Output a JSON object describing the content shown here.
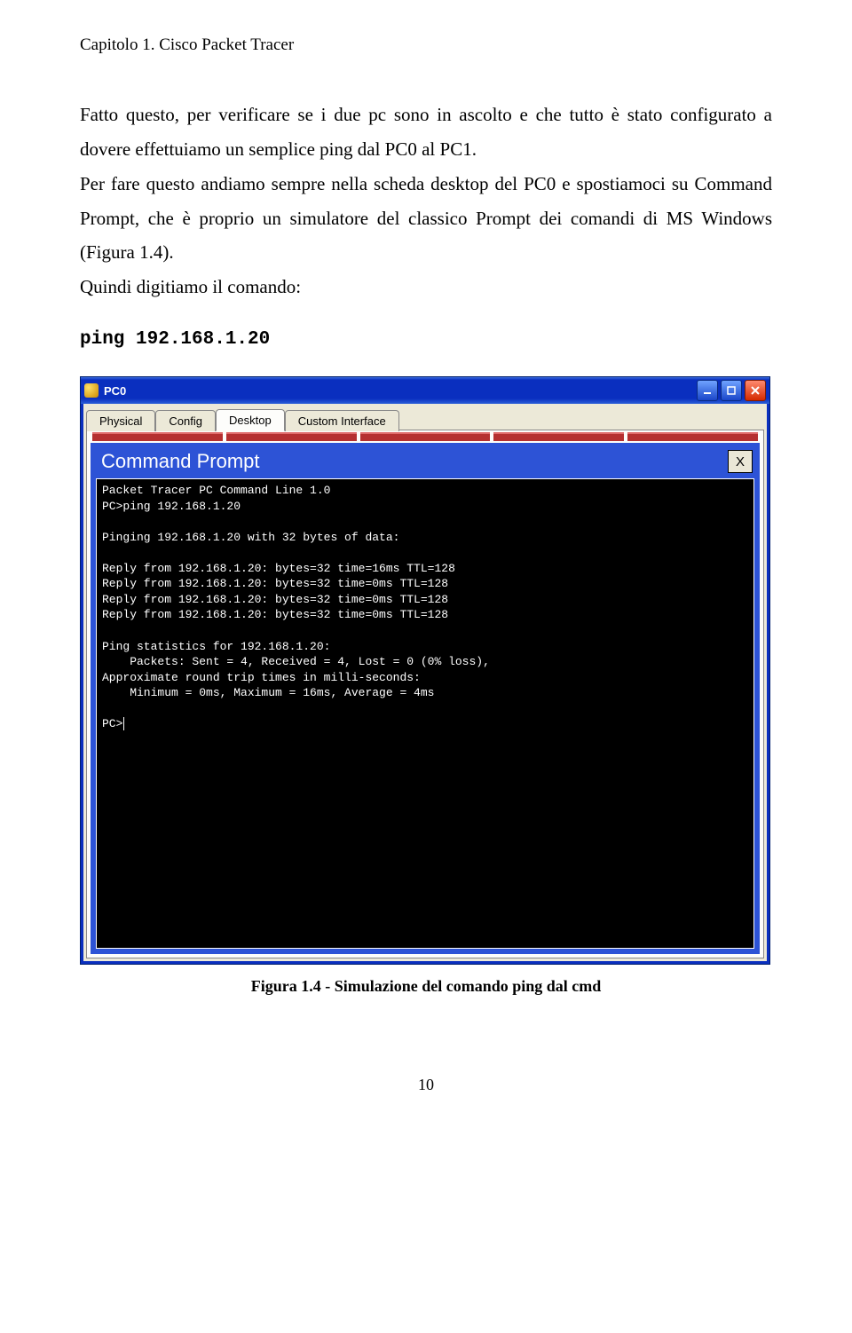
{
  "header": "Capitolo 1. Cisco Packet Tracer",
  "para1": "Fatto questo, per verificare se i due pc sono in ascolto e che tutto è stato configurato a dovere effettuiamo un semplice ping dal PC0 al PC1.",
  "para2": "Per fare questo andiamo sempre nella scheda desktop del PC0 e spostiamoci su Command Prompt, che è proprio un simulatore del classico Prompt dei comandi di MS Windows (Figura 1.4).",
  "para3": "Quindi digitiamo il comando:",
  "command": "ping 192.168.1.20",
  "window": {
    "title": "PC0",
    "tabs": [
      "Physical",
      "Config",
      "Desktop",
      "Custom Interface"
    ],
    "active_tab": "Desktop",
    "cp_title": "Command Prompt",
    "cp_close": "X",
    "terminal": "Packet Tracer PC Command Line 1.0\nPC>ping 192.168.1.20\n\nPinging 192.168.1.20 with 32 bytes of data:\n\nReply from 192.168.1.20: bytes=32 time=16ms TTL=128\nReply from 192.168.1.20: bytes=32 time=0ms TTL=128\nReply from 192.168.1.20: bytes=32 time=0ms TTL=128\nReply from 192.168.1.20: bytes=32 time=0ms TTL=128\n\nPing statistics for 192.168.1.20:\n    Packets: Sent = 4, Received = 4, Lost = 0 (0% loss),\nApproximate round trip times in milli-seconds:\n    Minimum = 0ms, Maximum = 16ms, Average = 4ms\n\nPC>"
  },
  "caption": "Figura 1.4 - Simulazione del comando ping dal cmd",
  "page_number": "10"
}
